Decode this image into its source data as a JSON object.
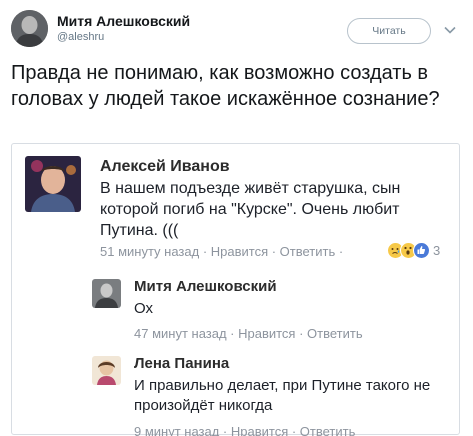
{
  "tweet": {
    "author_name": "Митя Алешковский",
    "author_handle": "@aleshru",
    "follow_label": "Читать",
    "text": "Правда не понимаю, как возможно создать в головах у людей такое искажённое сознание?"
  },
  "comments": [
    {
      "name": "Алексей Иванов",
      "text": "В нашем подъезде живёт старушка, сын которой погиб на \"Курске\". Очень любит Путина. (((",
      "meta": "51 минуту назад · Нравится · Ответить ·",
      "reaction_count": "3"
    },
    {
      "name": "Митя Алешковский",
      "text": "Ох",
      "meta": "47 минут назад · Нравится · Ответить"
    },
    {
      "name": "Лена Панина",
      "text": "И правильно делает, при Путине такого не произойдёт никогда",
      "meta": "9 минут назад · Нравится · Ответить"
    }
  ],
  "icons": {
    "chevron": "chevron-down-icon",
    "reactions": [
      "sad-reaction-icon",
      "wow-reaction-icon",
      "like-reaction-icon"
    ]
  },
  "colors": {
    "text": "#14171a",
    "muted": "#657786",
    "fb_meta": "#8d949e",
    "like_blue": "#4a7ad8",
    "reaction_yellow": "#f7c948"
  }
}
